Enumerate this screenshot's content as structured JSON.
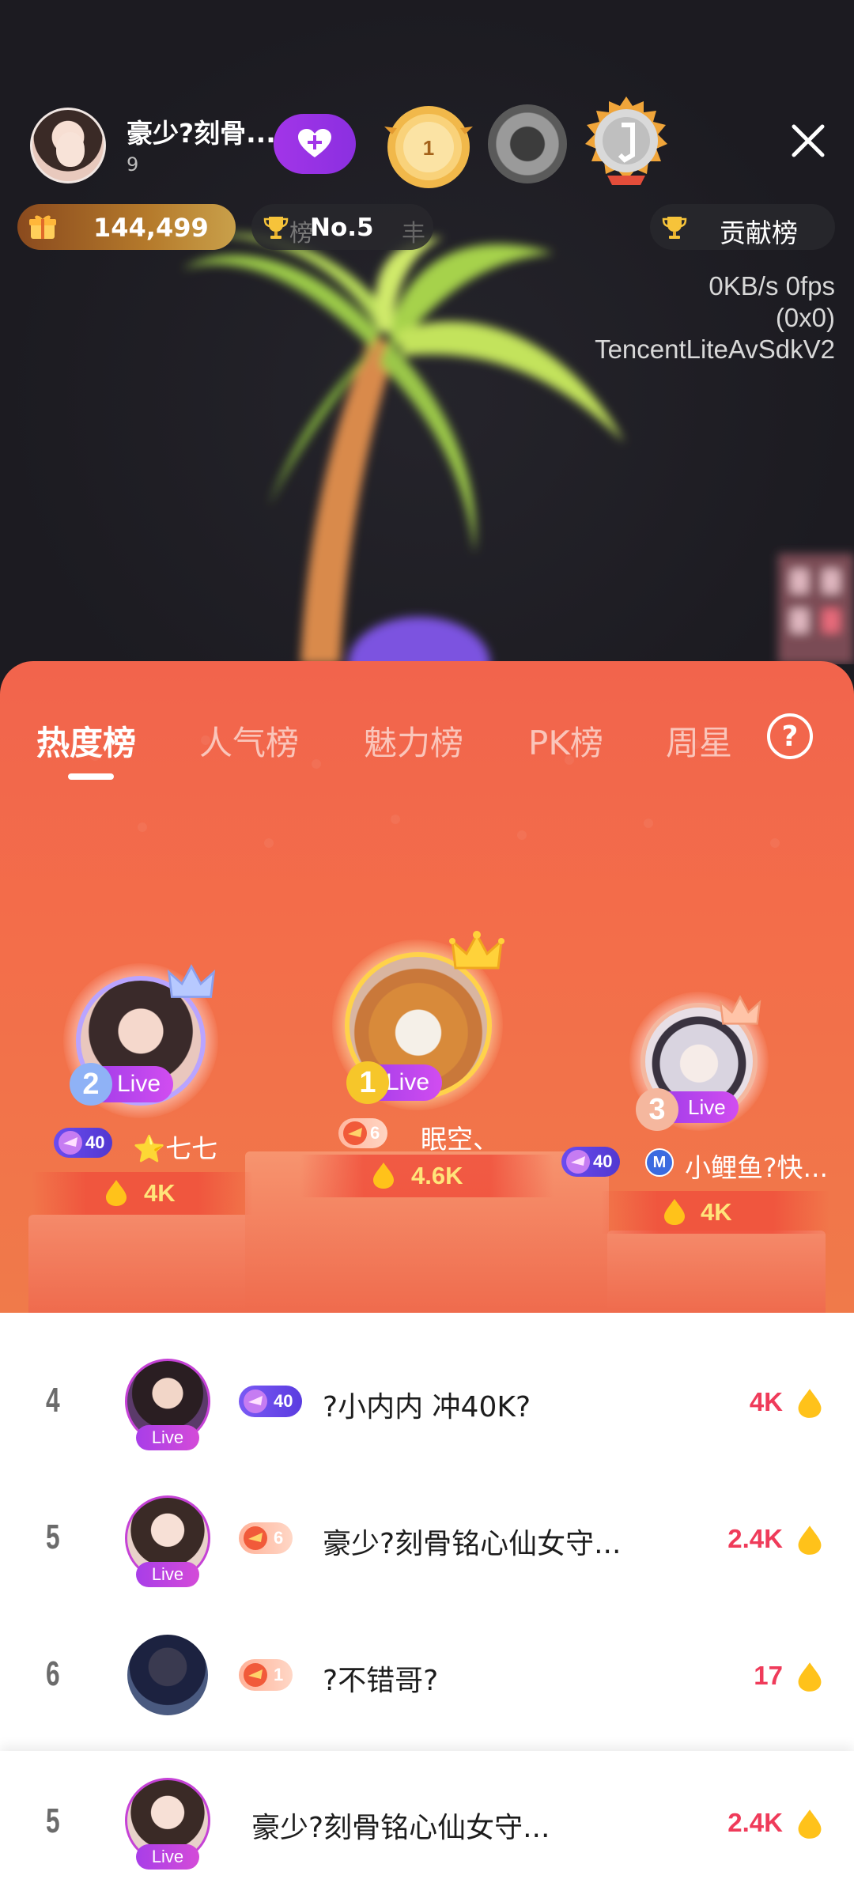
{
  "host": {
    "name": "豪少?刻骨...",
    "viewer_count": "9",
    "gold_badge_number": "1"
  },
  "stats": {
    "gift_count": "144,499",
    "rank_label": "No.5",
    "rank_prefix": "榜",
    "rank_suffix": "丰",
    "contribution_label": "贡献榜"
  },
  "debug": {
    "line1": "0KB/s 0fps",
    "line2": "(0x0)",
    "line3": "TencentLiteAvSdkV2"
  },
  "tabs": [
    "热度榜",
    "人气榜",
    "魅力榜",
    "PK榜",
    "周星"
  ],
  "help_label": "?",
  "live_label": "Live",
  "top3": [
    {
      "rank": "1",
      "name": "眠空、",
      "level": "6",
      "score": "4.6K"
    },
    {
      "rank": "2",
      "name": "⭐七七",
      "level": "40",
      "score": "4K"
    },
    {
      "rank": "3",
      "name": "小鲤鱼?快...",
      "prefix_badge": "M",
      "level": "40",
      "score": "4K"
    }
  ],
  "list": [
    {
      "rank": "4",
      "level": "40",
      "name": "?小内内 冲40K?",
      "score": "4K"
    },
    {
      "rank": "5",
      "level": "6",
      "name": "豪少?刻骨铭心仙女守...",
      "score": "2.4K"
    },
    {
      "rank": "6",
      "level": "1",
      "name": "?不错哥?",
      "score": "17"
    }
  ],
  "my_rank": {
    "rank": "5",
    "name": "豪少?刻骨铭心仙女守...",
    "score": "2.4K"
  },
  "colors": {
    "panel_top": "#f2644c",
    "score_red": "#ef3b5a",
    "gold_text": "#ffe57a",
    "live_purple": "#a83ee8"
  }
}
